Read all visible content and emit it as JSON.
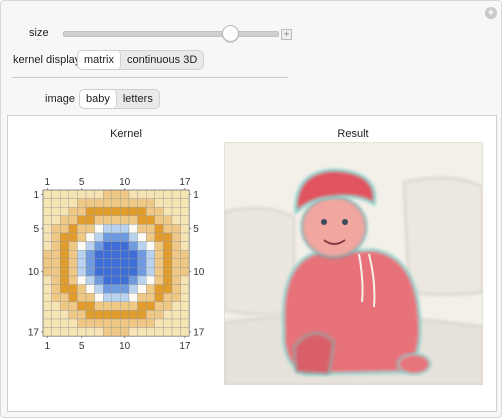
{
  "controls": {
    "size_label": "size",
    "size_value": 0.78,
    "plus_symbol": "+",
    "kernel_display_label": "kernel display",
    "kernel_display_options": [
      "matrix",
      "continuous 3D"
    ],
    "kernel_display_selected": "matrix",
    "image_label": "image",
    "image_options": [
      "baby",
      "letters"
    ],
    "image_selected": "baby"
  },
  "kernel": {
    "title": "Kernel",
    "size": 17,
    "tick_labels": [
      "1",
      "5",
      "10",
      "17"
    ],
    "tick_positions": [
      1,
      5,
      10,
      17
    ]
  },
  "result": {
    "title": "Result"
  },
  "icons": {
    "corner": "plus-circle-icon",
    "slider_step": "plus-box-icon"
  },
  "colors": {
    "blue_dark": "#3f6fd6",
    "blue_mid": "#6e9be0",
    "blue_light": "#b9d2ef",
    "white_ring": "#fdfbf4",
    "orange": "#e29c2c",
    "tan": "#eec884",
    "pale": "#f6e4b4"
  }
}
